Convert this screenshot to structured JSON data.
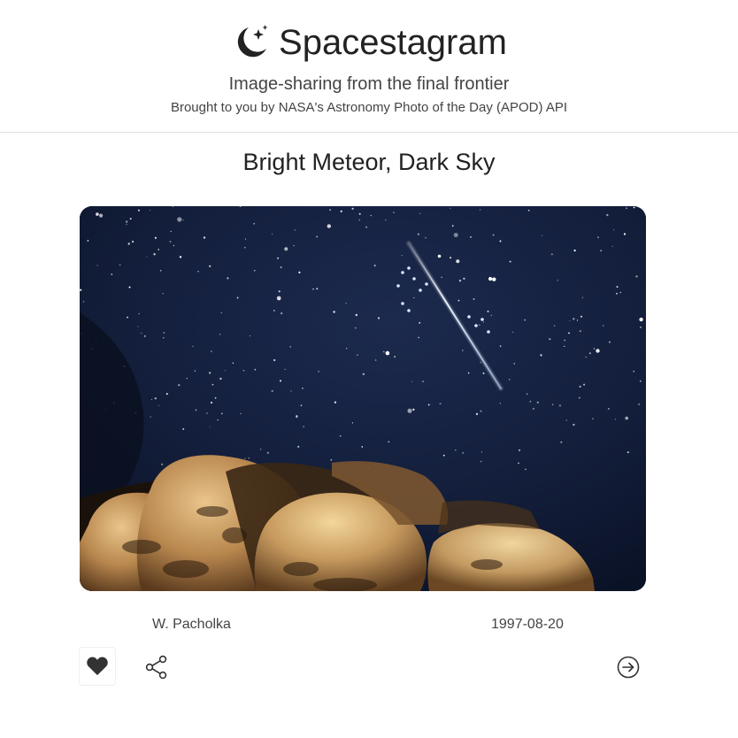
{
  "header": {
    "app_name": "Spacestagram",
    "logo_icon": "moon-stars-icon",
    "tagline": "Image-sharing from the final frontier",
    "subtagline": "Brought to you by NASA's Astronomy Photo of the Day (APOD) API"
  },
  "post": {
    "title": "Bright Meteor, Dark Sky",
    "author": "W. Pacholka",
    "date": "1997-08-20",
    "liked": true,
    "actions": {
      "like_icon": "heart-icon",
      "share_icon": "share-icon",
      "open_icon": "arrow-right-circle-icon"
    }
  },
  "colors": {
    "text_primary": "#222222",
    "text_secondary": "#444444",
    "icon": "#333333",
    "divider": "#dedede"
  }
}
